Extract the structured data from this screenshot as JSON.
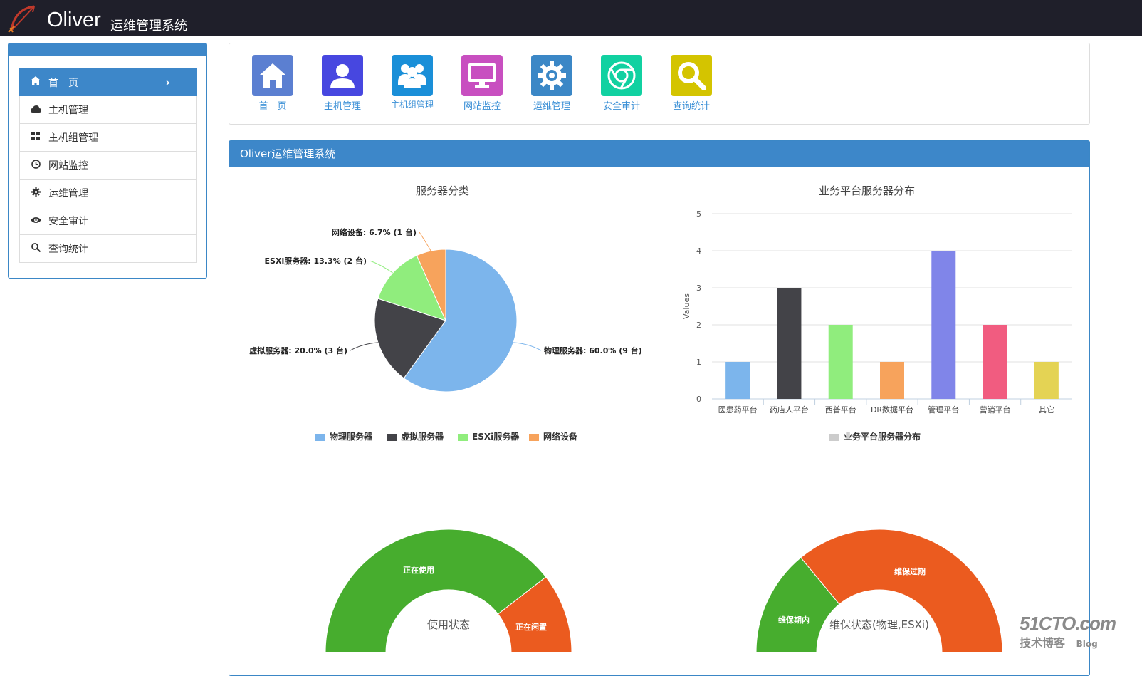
{
  "header": {
    "brand": "Oliver",
    "subtitle": "运维管理系统"
  },
  "sidebar": {
    "items": [
      {
        "label": "首　页",
        "icon": "home-icon",
        "active": true
      },
      {
        "label": "主机管理",
        "icon": "cloud-icon"
      },
      {
        "label": "主机组管理",
        "icon": "grid-icon"
      },
      {
        "label": "网站监控",
        "icon": "clock-icon"
      },
      {
        "label": "运维管理",
        "icon": "gear-icon"
      },
      {
        "label": "安全审计",
        "icon": "eye-icon"
      },
      {
        "label": "查询统计",
        "icon": "search-icon"
      }
    ]
  },
  "quick": {
    "items": [
      {
        "label": "首　页",
        "icon": "home-icon",
        "color": "#5b7fd1"
      },
      {
        "label": "主机管理",
        "icon": "user-icon",
        "color": "#4747e0"
      },
      {
        "label": "主机组管理",
        "icon": "users-icon",
        "color": "#1a8fd8"
      },
      {
        "label": "网站监控",
        "icon": "monitor-icon",
        "color": "#c84fc0"
      },
      {
        "label": "运维管理",
        "icon": "gear-icon",
        "color": "#3b87c6"
      },
      {
        "label": "安全审计",
        "icon": "chrome-icon",
        "color": "#11d1a1"
      },
      {
        "label": "查询统计",
        "icon": "search-icon",
        "color": "#d4c400"
      }
    ]
  },
  "panel": {
    "title": "Oliver运维管理系统"
  },
  "chart_data": [
    {
      "type": "pie",
      "title": "服务器分类",
      "slices": [
        {
          "name": "物理服务器",
          "value": 9,
          "percent": 60.0,
          "label": "物理服务器: 60.0% (9 台)",
          "color": "#7cb5ec"
        },
        {
          "name": "虚拟服务器",
          "value": 3,
          "percent": 20.0,
          "label": "虚拟服务器: 20.0% (3 台)",
          "color": "#434348"
        },
        {
          "name": "ESXi服务器",
          "value": 2,
          "percent": 13.3,
          "label": "ESXi服务器: 13.3% (2 台)",
          "color": "#90ed7d"
        },
        {
          "name": "网络设备",
          "value": 1,
          "percent": 6.7,
          "label": "网络设备: 6.7% (1 台)",
          "color": "#f7a35c"
        }
      ],
      "legend": "bottom"
    },
    {
      "type": "bar",
      "title": "业务平台服务器分布",
      "ylabel": "Values",
      "ylim": [
        0,
        5
      ],
      "yticks": [
        "0",
        "1",
        "2",
        "3",
        "4",
        "5"
      ],
      "categories": [
        "医患药平台",
        "药店人平台",
        "西普平台",
        "DR数据平台",
        "管理平台",
        "营销平台",
        "其它"
      ],
      "values": [
        1,
        3,
        2,
        1,
        4,
        2,
        1
      ],
      "colors": [
        "#7cb5ec",
        "#434348",
        "#90ed7d",
        "#f7a35c",
        "#8085e9",
        "#f15c80",
        "#e4d354"
      ],
      "series": [
        {
          "name": "业务平台服务器分布"
        }
      ],
      "legend_color": "#cccccc",
      "grid": true
    },
    {
      "type": "pie",
      "variant": "semi-donut",
      "title": "使用状态",
      "slices": [
        {
          "name": "正在使用",
          "color": "#47ad2e"
        },
        {
          "name": "正在闲置",
          "color": "#eb5b1f"
        }
      ]
    },
    {
      "type": "pie",
      "variant": "semi-donut",
      "title": "维保状态(物理,ESXi)",
      "slices": [
        {
          "name": "维保期内",
          "color": "#47ad2e"
        },
        {
          "name": "维保过期",
          "color": "#eb5b1f"
        }
      ]
    }
  ],
  "watermark": {
    "line1": "51CTO.com",
    "line2": "技术博客",
    "line3": "Blog"
  }
}
